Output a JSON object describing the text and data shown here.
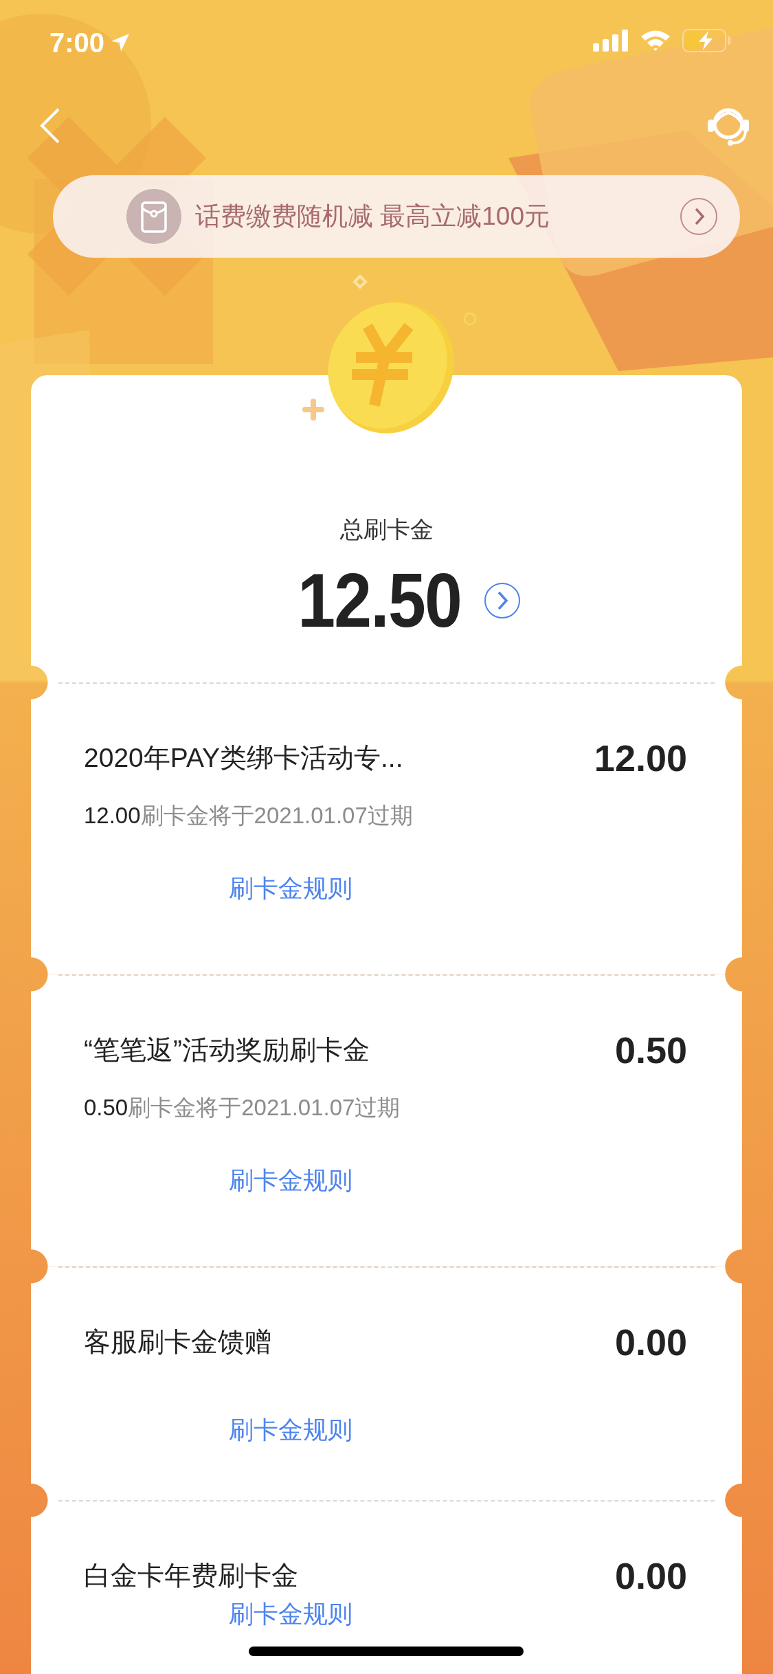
{
  "status_bar": {
    "time": "7:00"
  },
  "banner": {
    "text": "话费缴费随机减 最高立减100元"
  },
  "summary": {
    "label": "总刷卡金",
    "total": "12.50"
  },
  "items": [
    {
      "title": "2020年PAY类绑卡活动专...",
      "amount": "12.00",
      "expiry_amount": "12.00",
      "expiry_text": "刷卡金将于2021.01.07过期",
      "rule_link": "刷卡金规则"
    },
    {
      "title": "“笔笔返”活动奖励刷卡金",
      "amount": "0.50",
      "expiry_amount": "0.50",
      "expiry_text": "刷卡金将于2021.01.07过期",
      "rule_link": "刷卡金规则"
    },
    {
      "title": "客服刷卡金馈赠",
      "amount": "0.00",
      "rule_link": "刷卡金规则"
    },
    {
      "title": "白金卡年费刷卡金",
      "amount": "0.00",
      "rule_link": "刷卡金规则"
    }
  ]
}
